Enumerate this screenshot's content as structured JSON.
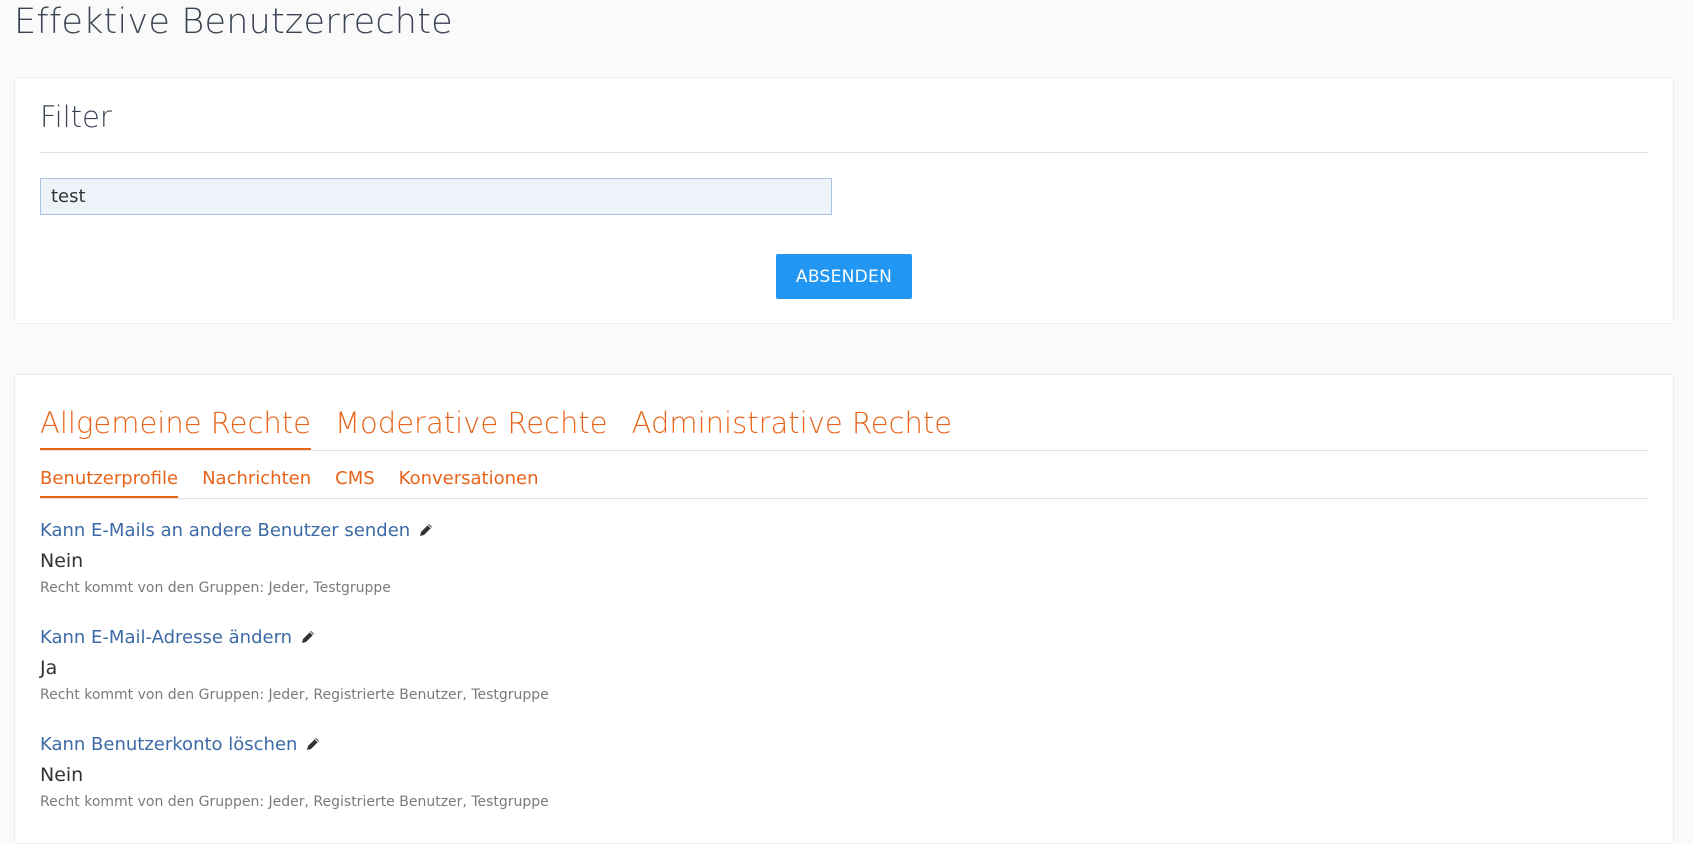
{
  "page": {
    "title": "Effektive Benutzerrechte"
  },
  "filter": {
    "title": "Filter",
    "input_value": "test",
    "submit_label": "ABSENDEN"
  },
  "rights": {
    "main_tabs": [
      {
        "label": "Allgemeine Rechte",
        "active": true
      },
      {
        "label": "Moderative Rechte",
        "active": false
      },
      {
        "label": "Administrative Rechte",
        "active": false
      }
    ],
    "sub_tabs": [
      {
        "label": "Benutzerprofile",
        "active": true
      },
      {
        "label": "Nachrichten",
        "active": false
      },
      {
        "label": "CMS",
        "active": false
      },
      {
        "label": "Konversationen",
        "active": false
      }
    ],
    "permissions": [
      {
        "title": "Kann E-Mails an andere Benutzer senden",
        "value": "Nein",
        "source": "Recht kommt von den Gruppen: Jeder, Testgruppe",
        "icon": "pencil-icon"
      },
      {
        "title": "Kann E-Mail-Adresse ändern",
        "value": "Ja",
        "source": "Recht kommt von den Gruppen: Jeder, Registrierte Benutzer, Testgruppe",
        "icon": "pencil-icon"
      },
      {
        "title": "Kann Benutzerkonto löschen",
        "value": "Nein",
        "source": "Recht kommt von den Gruppen: Jeder, Registrierte Benutzer, Testgruppe",
        "icon": "pencil-icon"
      }
    ]
  },
  "colors": {
    "accent_orange": "#e8641b",
    "link_blue": "#3c6aa6",
    "button_blue": "#2196f3"
  }
}
